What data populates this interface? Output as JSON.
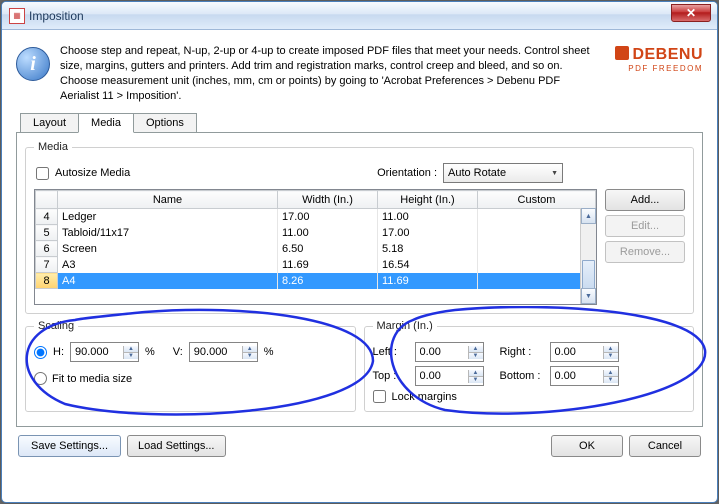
{
  "window": {
    "title": "Imposition"
  },
  "intro": "Choose step and repeat, N-up, 2-up or 4-up to create imposed PDF files that meet your needs. Control sheet size, margins, gutters and printers. Add trim and registration marks, control creep and bleed, and so on. Choose measurement unit (inches, mm, cm or points) by going to 'Acrobat Preferences > Debenu PDF Aerialist 11 > Imposition'.",
  "logo": {
    "name": "DEBENU",
    "tag": "PDF FREEDOM"
  },
  "tabs": {
    "layout": "Layout",
    "media": "Media",
    "options": "Options"
  },
  "media": {
    "legend": "Media",
    "autosize": "Autosize Media",
    "orientation_label": "Orientation :",
    "orientation_value": "Auto Rotate",
    "cols": {
      "name": "Name",
      "width": "Width (In.)",
      "height": "Height (In.)",
      "custom": "Custom"
    },
    "rows": [
      {
        "n": "4",
        "name": "Ledger",
        "w": "17.00",
        "h": "11.00"
      },
      {
        "n": "5",
        "name": "Tabloid/11x17",
        "w": "11.00",
        "h": "17.00"
      },
      {
        "n": "6",
        "name": "Screen",
        "w": "6.50",
        "h": "5.18"
      },
      {
        "n": "7",
        "name": "A3",
        "w": "11.69",
        "h": "16.54"
      },
      {
        "n": "8",
        "name": "A4",
        "w": "8.26",
        "h": "11.69"
      }
    ],
    "buttons": {
      "add": "Add...",
      "edit": "Edit...",
      "remove": "Remove..."
    }
  },
  "scaling": {
    "legend": "Scaling",
    "h_label": "H:",
    "h_value": "90.000",
    "v_label": "V:",
    "v_value": "90.000",
    "pct": "%",
    "fit": "Fit to media size"
  },
  "margin": {
    "legend": "Margin (In.)",
    "left_l": "Left :",
    "left_v": "0.00",
    "right_l": "Right :",
    "right_v": "0.00",
    "top_l": "Top :",
    "top_v": "0.00",
    "bottom_l": "Bottom :",
    "bottom_v": "0.00",
    "lock": "Lock margins"
  },
  "footer": {
    "save": "Save Settings...",
    "load": "Load Settings...",
    "ok": "OK",
    "cancel": "Cancel"
  }
}
